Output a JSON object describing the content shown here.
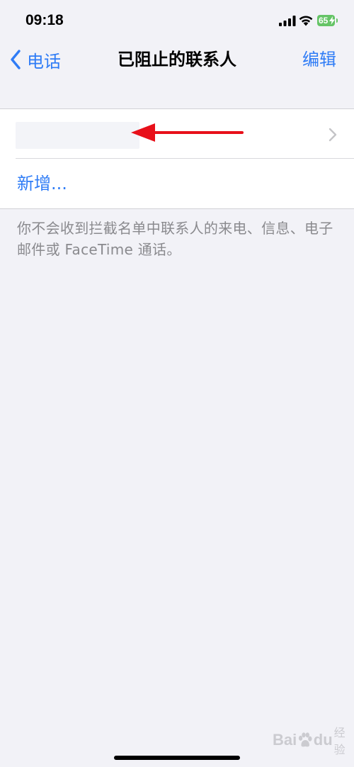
{
  "status_bar": {
    "time": "09:18",
    "battery_level": "65",
    "battery_color": "#65c466",
    "icons": [
      "signal-icon",
      "wifi-icon",
      "battery-icon"
    ]
  },
  "nav": {
    "back_label": "电话",
    "title": "已阻止的联系人",
    "edit_label": "编辑",
    "accent_color": "#2f7cf6"
  },
  "list": {
    "blocked_contact_label": "",
    "add_label": "新增..."
  },
  "footer": {
    "note": "你不会收到拦截名单中联系人的来电、信息、电子邮件或 FaceTime 通话。"
  },
  "annotation": {
    "arrow_color": "#e8101a"
  },
  "watermark": {
    "text_left": "Bai",
    "text_right": "du",
    "text_sub": "经验"
  }
}
